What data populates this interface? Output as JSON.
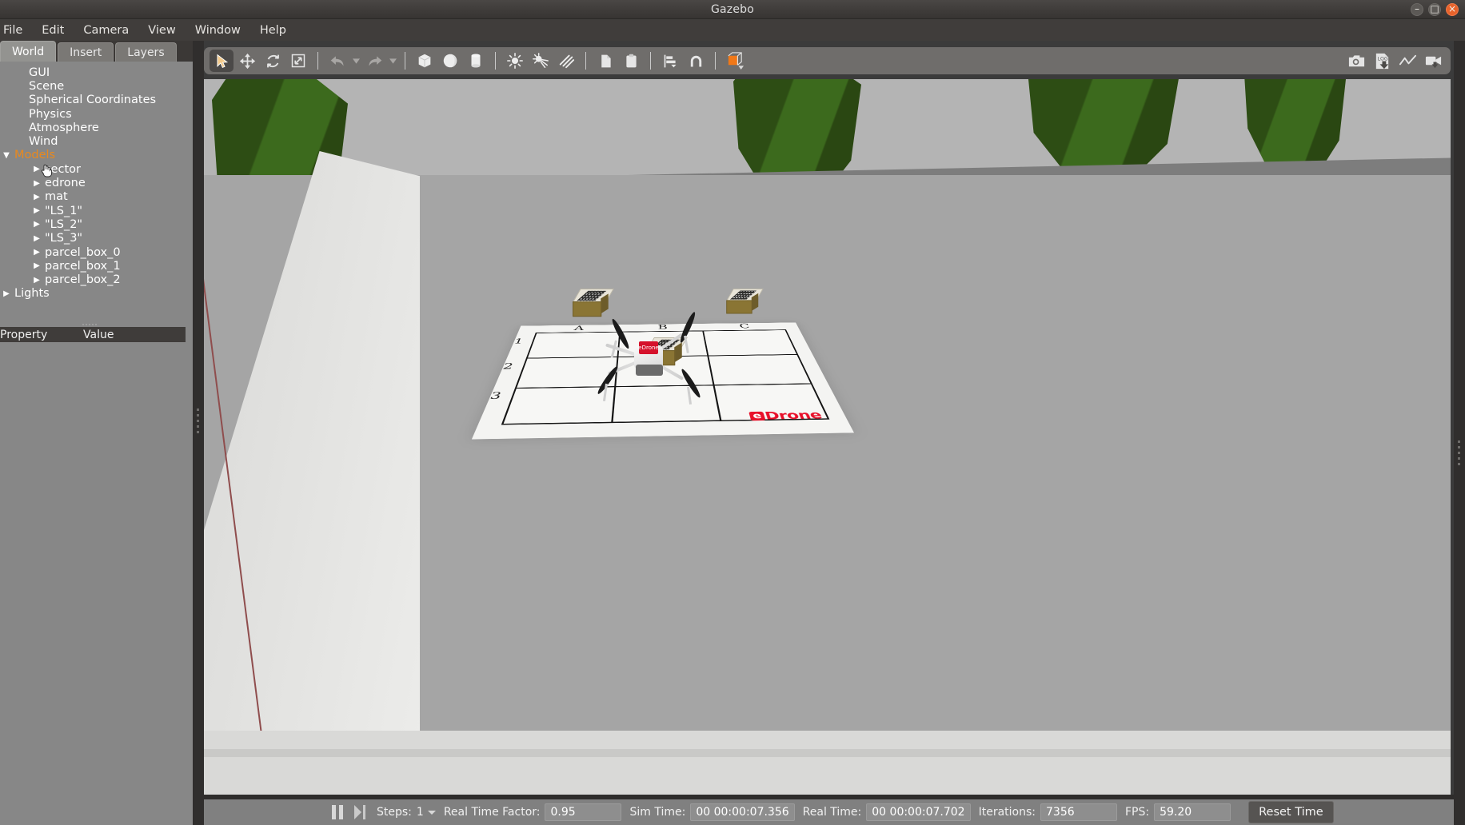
{
  "window": {
    "title": "Gazebo",
    "controls": {
      "minimize": "–",
      "maximize": "□",
      "close": "×"
    }
  },
  "menubar": {
    "items": [
      {
        "label": "File"
      },
      {
        "label": "Edit"
      },
      {
        "label": "Camera"
      },
      {
        "label": "View"
      },
      {
        "label": "Window"
      },
      {
        "label": "Help"
      }
    ]
  },
  "left_panel": {
    "tabs": [
      {
        "label": "World",
        "active": true
      },
      {
        "label": "Insert",
        "active": false
      },
      {
        "label": "Layers",
        "active": false
      }
    ],
    "tree": [
      {
        "label": "GUI",
        "level": 1,
        "arrow": "none",
        "highlight": false
      },
      {
        "label": "Scene",
        "level": 1,
        "arrow": "none",
        "highlight": false
      },
      {
        "label": "Spherical Coordinates",
        "level": 1,
        "arrow": "none",
        "highlight": false
      },
      {
        "label": "Physics",
        "level": 1,
        "arrow": "none",
        "highlight": false
      },
      {
        "label": "Atmosphere",
        "level": 1,
        "arrow": "none",
        "highlight": false
      },
      {
        "label": "Wind",
        "level": 1,
        "arrow": "none",
        "highlight": false
      },
      {
        "label": "Models",
        "level": 0,
        "arrow": "expanded",
        "highlight": true
      },
      {
        "label": "sector",
        "level": 2,
        "arrow": "collapsed",
        "highlight": false
      },
      {
        "label": "edrone",
        "level": 2,
        "arrow": "collapsed",
        "highlight": false
      },
      {
        "label": "mat",
        "level": 2,
        "arrow": "collapsed",
        "highlight": false
      },
      {
        "label": "\"LS_1\"",
        "level": 2,
        "arrow": "collapsed",
        "highlight": false
      },
      {
        "label": "\"LS_2\"",
        "level": 2,
        "arrow": "collapsed",
        "highlight": false
      },
      {
        "label": "\"LS_3\"",
        "level": 2,
        "arrow": "collapsed",
        "highlight": false
      },
      {
        "label": "parcel_box_0",
        "level": 2,
        "arrow": "collapsed",
        "highlight": false
      },
      {
        "label": "parcel_box_1",
        "level": 2,
        "arrow": "collapsed",
        "highlight": false
      },
      {
        "label": "parcel_box_2",
        "level": 2,
        "arrow": "collapsed",
        "highlight": false
      },
      {
        "label": "Lights",
        "level": 0,
        "arrow": "collapsed",
        "highlight": false
      }
    ],
    "property_table": {
      "col_property": "Property",
      "col_value": "Value",
      "rows": []
    }
  },
  "toolbar": {
    "left_tools": [
      {
        "name": "selection-mode",
        "active": true
      },
      {
        "name": "translate-mode",
        "active": false
      },
      {
        "name": "rotate-mode",
        "active": false
      },
      {
        "name": "scale-mode",
        "active": false
      },
      {
        "name": "undo",
        "active": false
      },
      {
        "name": "redo",
        "active": false
      },
      {
        "name": "insert-box",
        "active": false
      },
      {
        "name": "insert-sphere",
        "active": false
      },
      {
        "name": "insert-cylinder",
        "active": false
      },
      {
        "name": "point-light",
        "active": false
      },
      {
        "name": "spot-light",
        "active": false
      },
      {
        "name": "directional-light",
        "active": false
      },
      {
        "name": "copy",
        "active": false
      },
      {
        "name": "paste",
        "active": false
      },
      {
        "name": "align",
        "active": false
      },
      {
        "name": "snap",
        "active": false
      },
      {
        "name": "change-view-angle",
        "active": false
      }
    ],
    "right_tools": [
      {
        "name": "screenshot"
      },
      {
        "name": "log-record"
      },
      {
        "name": "plot"
      },
      {
        "name": "video-record"
      }
    ]
  },
  "statusbar": {
    "pause_label": "pause",
    "step_label": "step",
    "steps_label": "Steps:",
    "steps_value": "1",
    "rtf_label": "Real Time Factor:",
    "rtf_value": "0.95",
    "sim_time_label": "Sim Time:",
    "sim_time_value": "00 00:00:07.356",
    "real_time_label": "Real Time:",
    "real_time_value": "00 00:00:07.702",
    "iterations_label": "Iterations:",
    "iterations_value": "7356",
    "fps_label": "FPS:",
    "fps_value": "59.20",
    "reset_button": "Reset Time"
  },
  "scene": {
    "mat": {
      "columns": [
        "A",
        "B",
        "C"
      ],
      "rows": [
        "1",
        "2",
        "3"
      ],
      "logo_text": "Drone",
      "logo_mark": "e",
      "logo_color": "#e8102a"
    },
    "objects": {
      "drone_label": "edrone",
      "drone_logo": "eDrone",
      "parcels": [
        "parcel_box_0",
        "parcel_box_1",
        "parcel_box_2"
      ],
      "parcel_positions": [
        "A1",
        "B2",
        "C1"
      ]
    },
    "colors": {
      "sky": "#b4b4b4",
      "grass": "#4e8029",
      "ground": "#a3a3a3",
      "wall": "#e9e9e7",
      "tree_dark": "#2d4d14",
      "tree_light": "#3c6a1d",
      "trunk": "#4a2d1c"
    }
  }
}
